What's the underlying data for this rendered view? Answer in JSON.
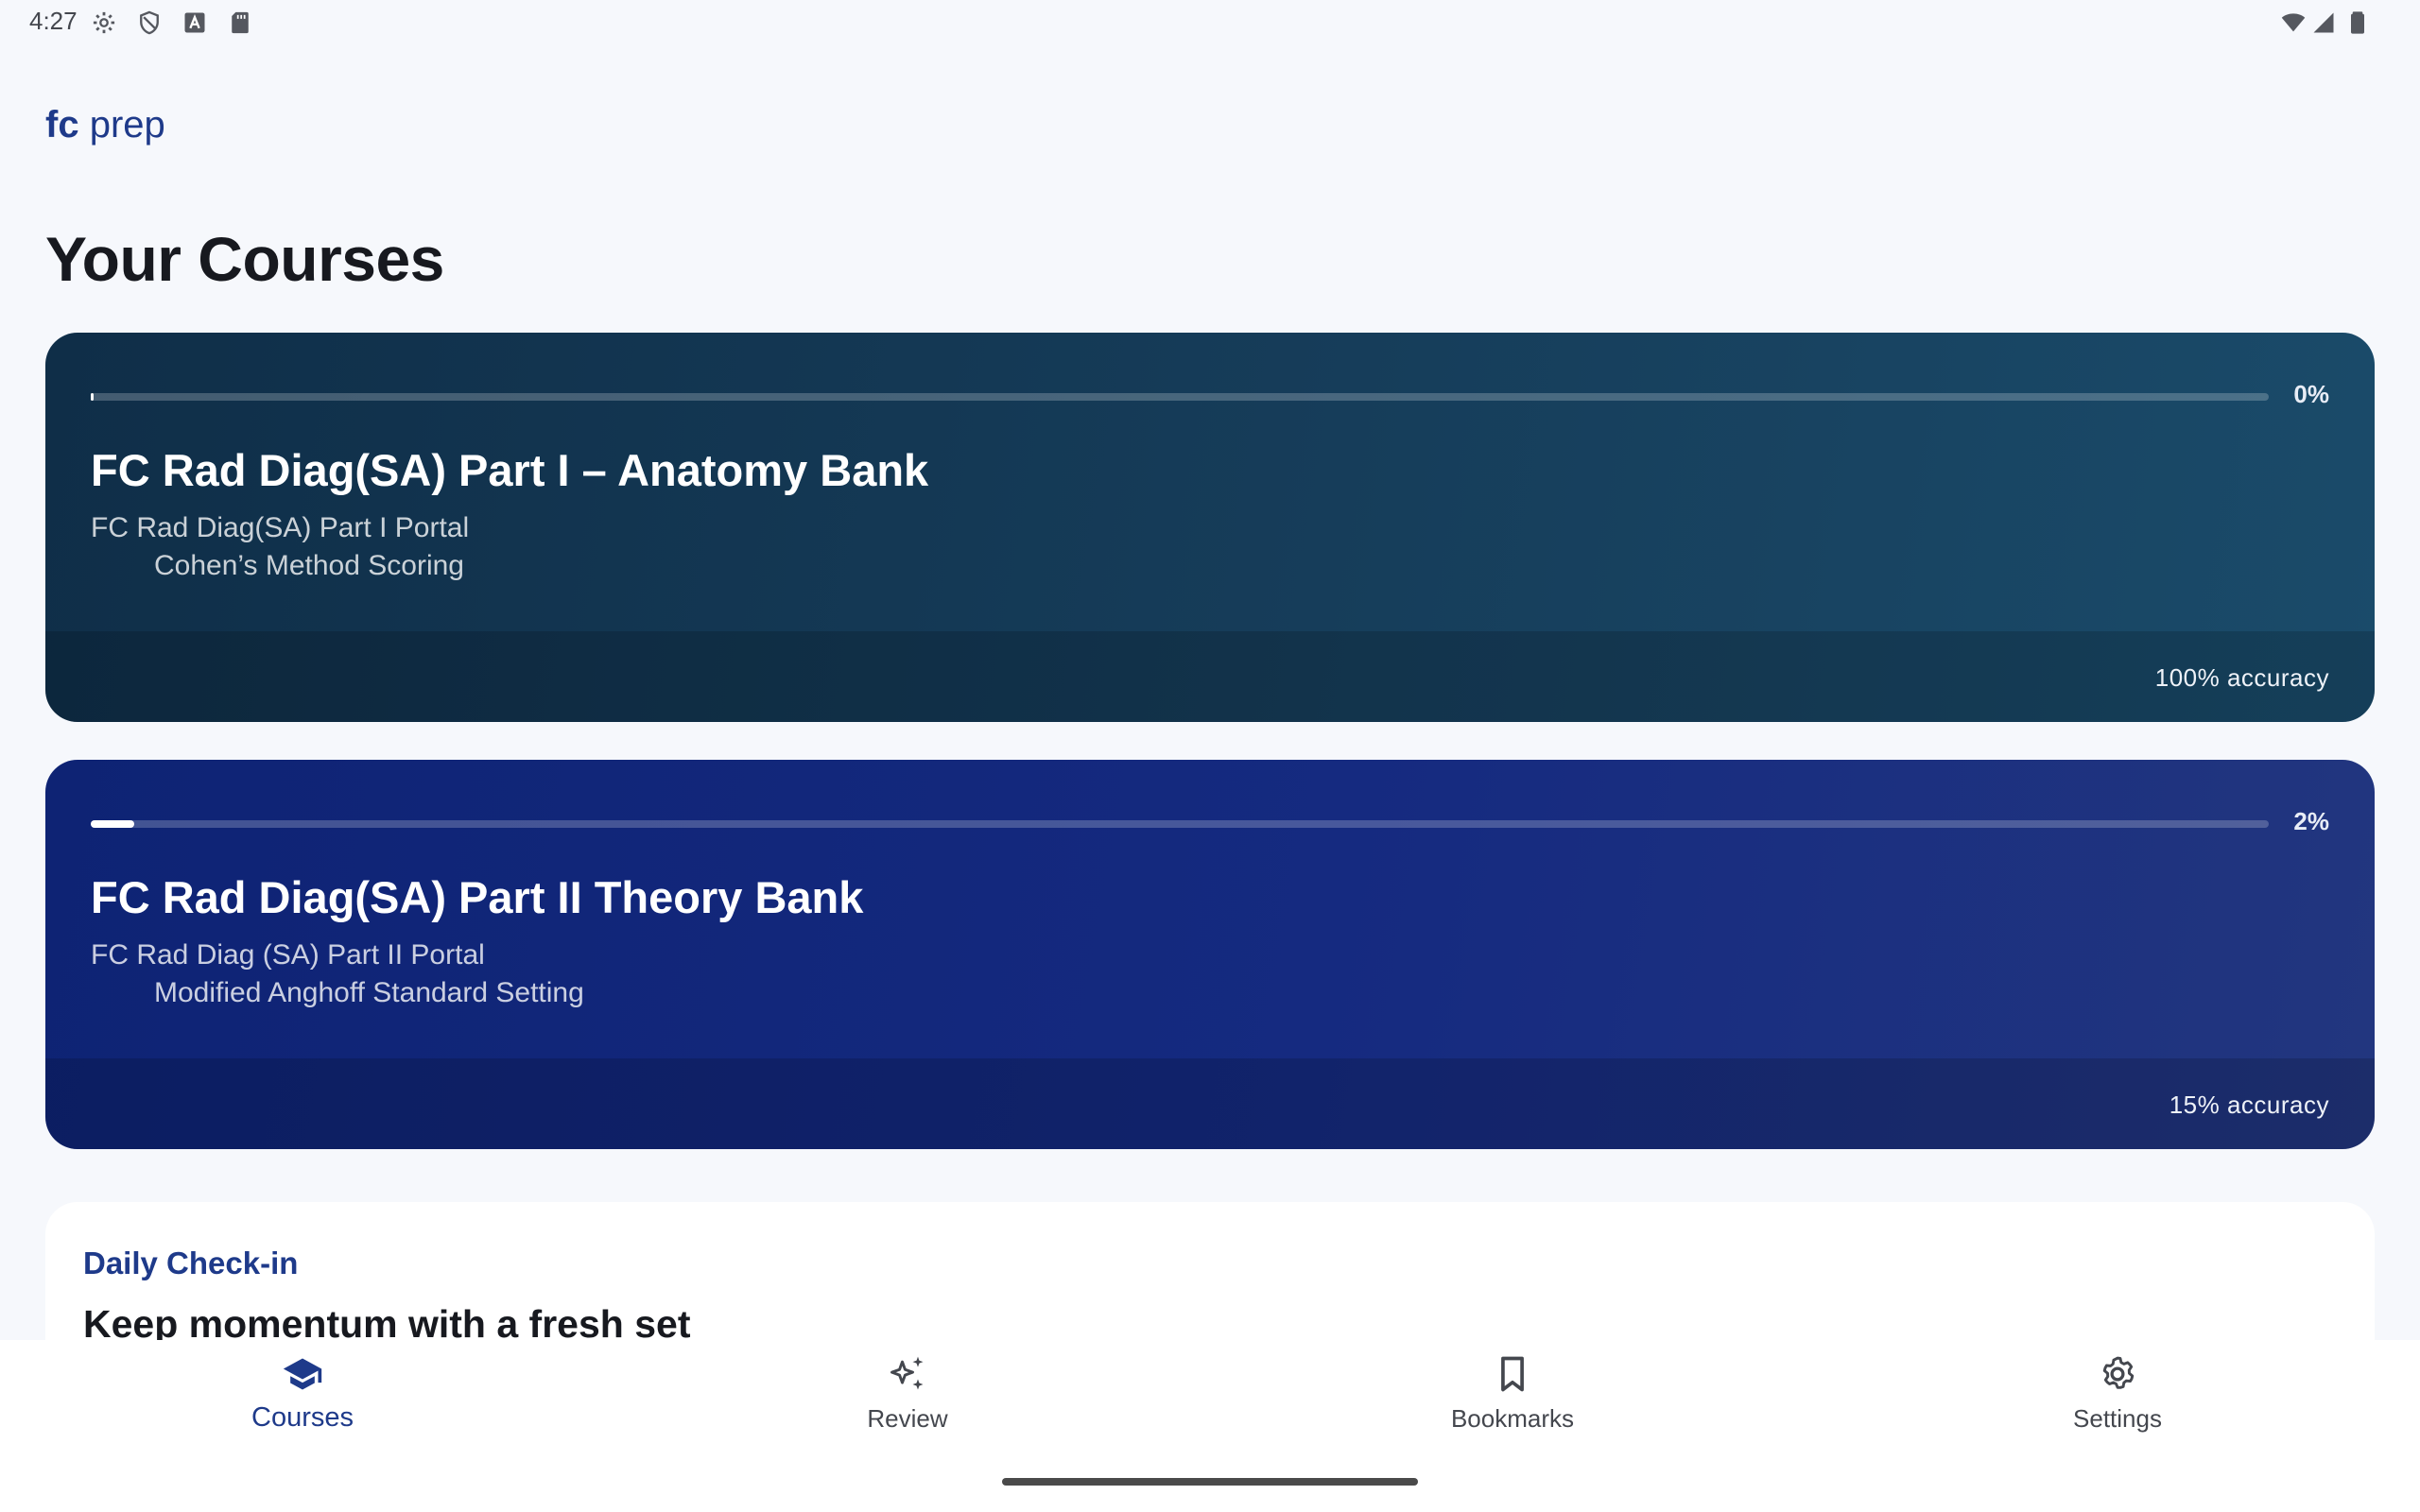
{
  "status_bar": {
    "time": "4:27",
    "left_icons": [
      "settings-icon",
      "shield-icon",
      "text-a-icon",
      "sd-card-icon"
    ],
    "right_icons": [
      "wifi-icon",
      "signal-icon",
      "battery-icon"
    ]
  },
  "brand": {
    "fc": "fc",
    "prep": "prep"
  },
  "page_title": "Your Courses",
  "courses": [
    {
      "progress_percent": 0,
      "progress_label": "0%",
      "title": "FC Rad Diag(SA) Part I – Anatomy Bank",
      "portal": "FC Rad Diag(SA) Part I Portal",
      "method": "Cohen’s Method Scoring",
      "accuracy": "100% accuracy",
      "color_start": "#0f2e48",
      "color_end": "#1a4b6a"
    },
    {
      "progress_percent": 2,
      "progress_label": "2%",
      "title": "FC Rad Diag(SA) Part II Theory Bank",
      "portal": "FC Rad Diag (SA) Part II Portal",
      "method": "Modified Anghoff Standard Setting",
      "accuracy": "15% accuracy",
      "color_start": "#0e2374",
      "color_end": "#22367f"
    }
  ],
  "daily_checkin": {
    "label": "Daily Check-in",
    "headline": "Keep momentum with a fresh set"
  },
  "bottom_nav": {
    "items": [
      {
        "label": "Courses",
        "icon": "graduation-cap-icon",
        "active": true
      },
      {
        "label": "Review",
        "icon": "sparkle-icon",
        "active": false
      },
      {
        "label": "Bookmarks",
        "icon": "bookmark-icon",
        "active": false
      },
      {
        "label": "Settings",
        "icon": "gear-icon",
        "active": false
      }
    ]
  },
  "colors": {
    "accent": "#1e3a8a",
    "background": "#f6f8fc"
  }
}
